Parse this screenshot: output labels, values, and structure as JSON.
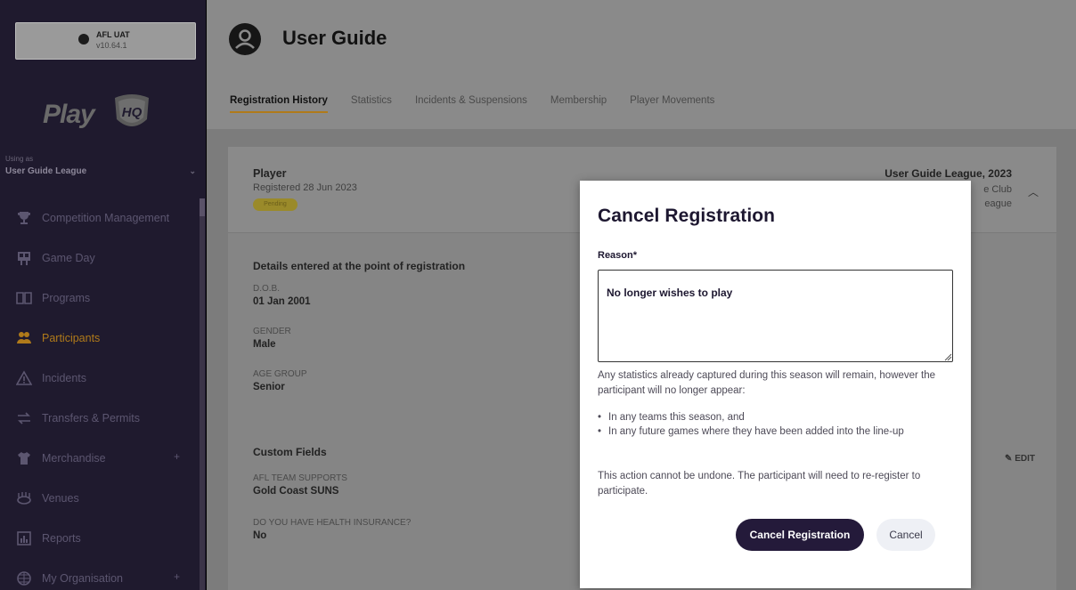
{
  "sidebar": {
    "env_name": "AFL UAT",
    "env_version": "v10.64.1",
    "logo_text": "Play",
    "logo_badge": "HQ",
    "using_as_label": "Using as",
    "org_name": "User Guide League",
    "nav": [
      {
        "label": "Competition Management",
        "icon": "trophy-icon"
      },
      {
        "label": "Game Day",
        "icon": "scoreboard-icon"
      },
      {
        "label": "Programs",
        "icon": "book-icon"
      },
      {
        "label": "Participants",
        "icon": "people-icon",
        "active": true
      },
      {
        "label": "Incidents",
        "icon": "warning-icon"
      },
      {
        "label": "Transfers & Permits",
        "icon": "transfer-icon"
      },
      {
        "label": "Merchandise",
        "icon": "shirt-icon",
        "expandable": true
      },
      {
        "label": "Venues",
        "icon": "stadium-icon"
      },
      {
        "label": "Reports",
        "icon": "report-icon"
      },
      {
        "label": "My Organisation",
        "icon": "globe-icon",
        "expandable": true
      }
    ],
    "accent_color": "#b07a1a"
  },
  "header": {
    "title": "User Guide",
    "tabs": [
      {
        "label": "Registration History",
        "active": true
      },
      {
        "label": "Statistics"
      },
      {
        "label": "Incidents & Suspensions"
      },
      {
        "label": "Membership"
      },
      {
        "label": "Player Movements"
      }
    ]
  },
  "registration": {
    "role": "Player",
    "registered_date": "Registered 28 Jun 2023",
    "status_badge": "Pending",
    "season": "User Guide League, 2023",
    "club_partial": "e Club",
    "league_partial": "eague",
    "details_title": "Details entered at the point of registration",
    "fields": [
      {
        "label": "D.O.B.",
        "value": "01 Jan 2001"
      },
      {
        "label": "GENDER",
        "value": "Male"
      },
      {
        "label": "AGE GROUP",
        "value": "Senior"
      }
    ],
    "custom_title": "Custom Fields",
    "edit_label": "EDIT",
    "custom_fields": [
      {
        "label": "AFL TEAM SUPPORTS",
        "value": "Gold Coast SUNS"
      },
      {
        "label": "DO YOU HAVE HEALTH INSURANCE?",
        "value": "No"
      }
    ]
  },
  "modal": {
    "title": "Cancel Registration",
    "reason_label": "Reason*",
    "reason_value": "No longer wishes to play",
    "info_text": "Any statistics already captured during this season will remain, however the participant will no longer appear:",
    "bullets": [
      "In any teams this season, and",
      "In any future games where they have been added into the line-up"
    ],
    "warning_text": "This action cannot be undone. The participant will need to re-register to participate.",
    "confirm_label": "Cancel Registration",
    "cancel_label": "Cancel",
    "primary_color": "#241a3a"
  }
}
